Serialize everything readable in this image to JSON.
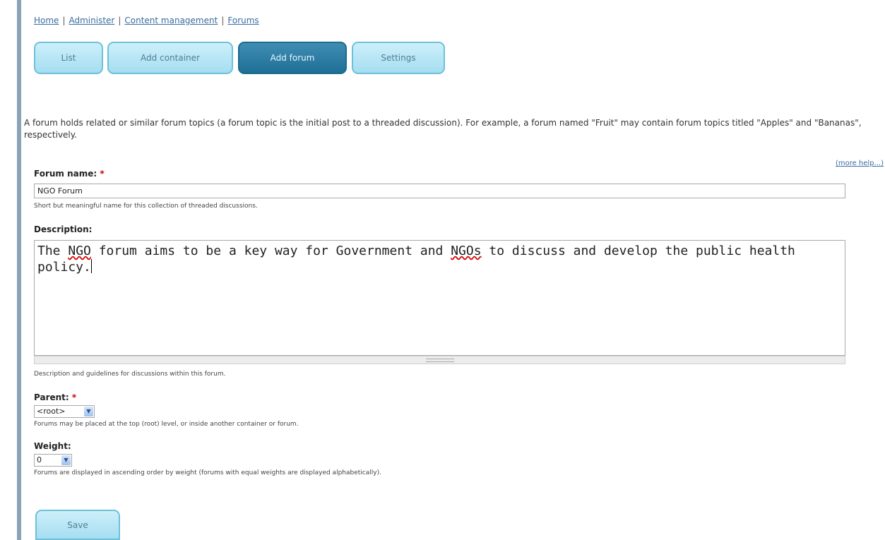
{
  "breadcrumb": [
    "Home",
    "Administer",
    "Content management",
    "Forums"
  ],
  "tabs": [
    {
      "label": "List",
      "active": false
    },
    {
      "label": "Add container",
      "active": false
    },
    {
      "label": "Add forum",
      "active": true
    },
    {
      "label": "Settings",
      "active": false
    }
  ],
  "intro": "A forum holds related or similar forum topics (a forum topic is the initial post to a threaded discussion). For example, a forum named \"Fruit\" may contain forum topics titled \"Apples\" and \"Bananas\", respectively.",
  "more_help": "(more help...)",
  "form": {
    "forum_name": {
      "label": "Forum name:",
      "required": "*",
      "value": "NGO Forum",
      "help": "Short but meaningful name for this collection of threaded discussions."
    },
    "description": {
      "label": "Description:",
      "text_part1": "The ",
      "text_ngo": "NGO",
      "text_part2": " forum aims to be a key way for Government and ",
      "text_ngos": "NGOs",
      "text_part3": " to discuss and develop the public health policy.",
      "help": "Description and guidelines for discussions within this forum."
    },
    "parent": {
      "label": "Parent:",
      "required": "*",
      "value": "<root>",
      "help": "Forums may be placed at the top (root) level, or inside another container or forum."
    },
    "weight": {
      "label": "Weight:",
      "value": "0",
      "help": "Forums are displayed in ascending order by weight (forums with equal weights are displayed alphabetically)."
    },
    "save_label": "Save"
  },
  "colors": {
    "accent": "#1f6f96",
    "tab_bg": "#a5def1",
    "required": "#cc0000",
    "link": "#3a6da0"
  },
  "icons": {
    "select_arrow": "chevron-down-icon"
  }
}
